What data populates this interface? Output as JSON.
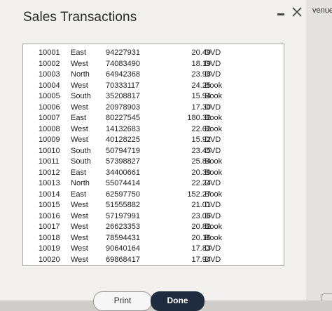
{
  "dialog": {
    "title": "Sales Transactions",
    "side_label": "venue"
  },
  "table": {
    "rows": [
      {
        "id": "10001",
        "region": "East",
        "number": "94227931",
        "amount": "20.49",
        "type": "DVD"
      },
      {
        "id": "10002",
        "region": "West",
        "number": "74083490",
        "amount": "18.19",
        "type": "DVD"
      },
      {
        "id": "10003",
        "region": "North",
        "number": "64942368",
        "amount": "23.98",
        "type": "DVD"
      },
      {
        "id": "10004",
        "region": "West",
        "number": "70333117",
        "amount": "24.25",
        "type": "Book"
      },
      {
        "id": "10005",
        "region": "South",
        "number": "35208817",
        "amount": "15.94",
        "type": "Book"
      },
      {
        "id": "10006",
        "region": "West",
        "number": "20978903",
        "amount": "17.30",
        "type": "DVD"
      },
      {
        "id": "10007",
        "region": "East",
        "number": "80227545",
        "amount": "180.32",
        "type": "Book"
      },
      {
        "id": "10008",
        "region": "West",
        "number": "14132683",
        "amount": "22.62",
        "type": "Book"
      },
      {
        "id": "10009",
        "region": "West",
        "number": "40128225",
        "amount": "15.92",
        "type": "DVD"
      },
      {
        "id": "10010",
        "region": "South",
        "number": "50794719",
        "amount": "23.45",
        "type": "DVD"
      },
      {
        "id": "10011",
        "region": "South",
        "number": "57398827",
        "amount": "25.84",
        "type": "Book"
      },
      {
        "id": "10012",
        "region": "East",
        "number": "34400661",
        "amount": "20.39",
        "type": "Book"
      },
      {
        "id": "10013",
        "region": "North",
        "number": "55074414",
        "amount": "22.24",
        "type": "DVD"
      },
      {
        "id": "10014",
        "region": "East",
        "number": "62597750",
        "amount": "152.27",
        "type": "Book"
      },
      {
        "id": "10015",
        "region": "West",
        "number": "51555882",
        "amount": "21.01",
        "type": "DVD"
      },
      {
        "id": "10016",
        "region": "West",
        "number": "57197991",
        "amount": "23.06",
        "type": "DVD"
      },
      {
        "id": "10017",
        "region": "West",
        "number": "26623353",
        "amount": "20.82",
        "type": "Book"
      },
      {
        "id": "10018",
        "region": "West",
        "number": "78594431",
        "amount": "20.16",
        "type": "Book"
      },
      {
        "id": "10019",
        "region": "West",
        "number": "90640164",
        "amount": "17.83",
        "type": "DVD"
      },
      {
        "id": "10020",
        "region": "West",
        "number": "69868417",
        "amount": "17.94",
        "type": "DVD"
      }
    ]
  },
  "buttons": {
    "print_label": "Print",
    "done_label": "Done"
  },
  "icons": {
    "minimize": "minimize-icon",
    "close": "close-icon"
  },
  "colors": {
    "done_button": "#1f2c3d",
    "dialog_bg": "#f2f1ef"
  }
}
